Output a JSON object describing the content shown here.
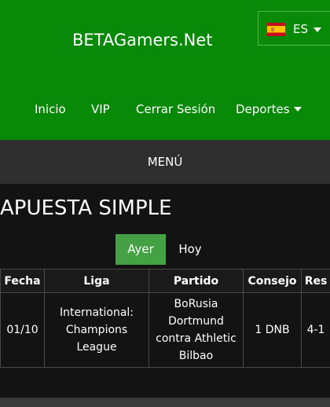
{
  "header": {
    "brand": "BETAGamers.Net",
    "language": {
      "code": "ES",
      "flag_icon": "spain-flag-icon",
      "flag_colors": [
        "#c60b1e",
        "#ffc400"
      ]
    },
    "nav": [
      {
        "label": "Inicio"
      },
      {
        "label": "VIP"
      },
      {
        "label": "Cerrar Sesión"
      },
      {
        "label": "Deportes",
        "has_dropdown": true
      }
    ],
    "background_color": "#088a08"
  },
  "menu": {
    "label": "MENÚ"
  },
  "main": {
    "title": "APUESTA SIMPLE",
    "tabs": [
      {
        "label": "Ayer",
        "active": true
      },
      {
        "label": "Hoy",
        "active": false
      }
    ],
    "active_tab_color": "#44a244",
    "table": {
      "headers": [
        "Fecha",
        "Liga",
        "Partido",
        "Consejo",
        "Res"
      ],
      "rows": [
        {
          "fecha": "01/10",
          "liga": "International: Champions League",
          "partido": "BoRusia Dortmund contra Athletic Bilbao",
          "consejo": "1 DNB",
          "res": "4-1"
        }
      ]
    }
  }
}
